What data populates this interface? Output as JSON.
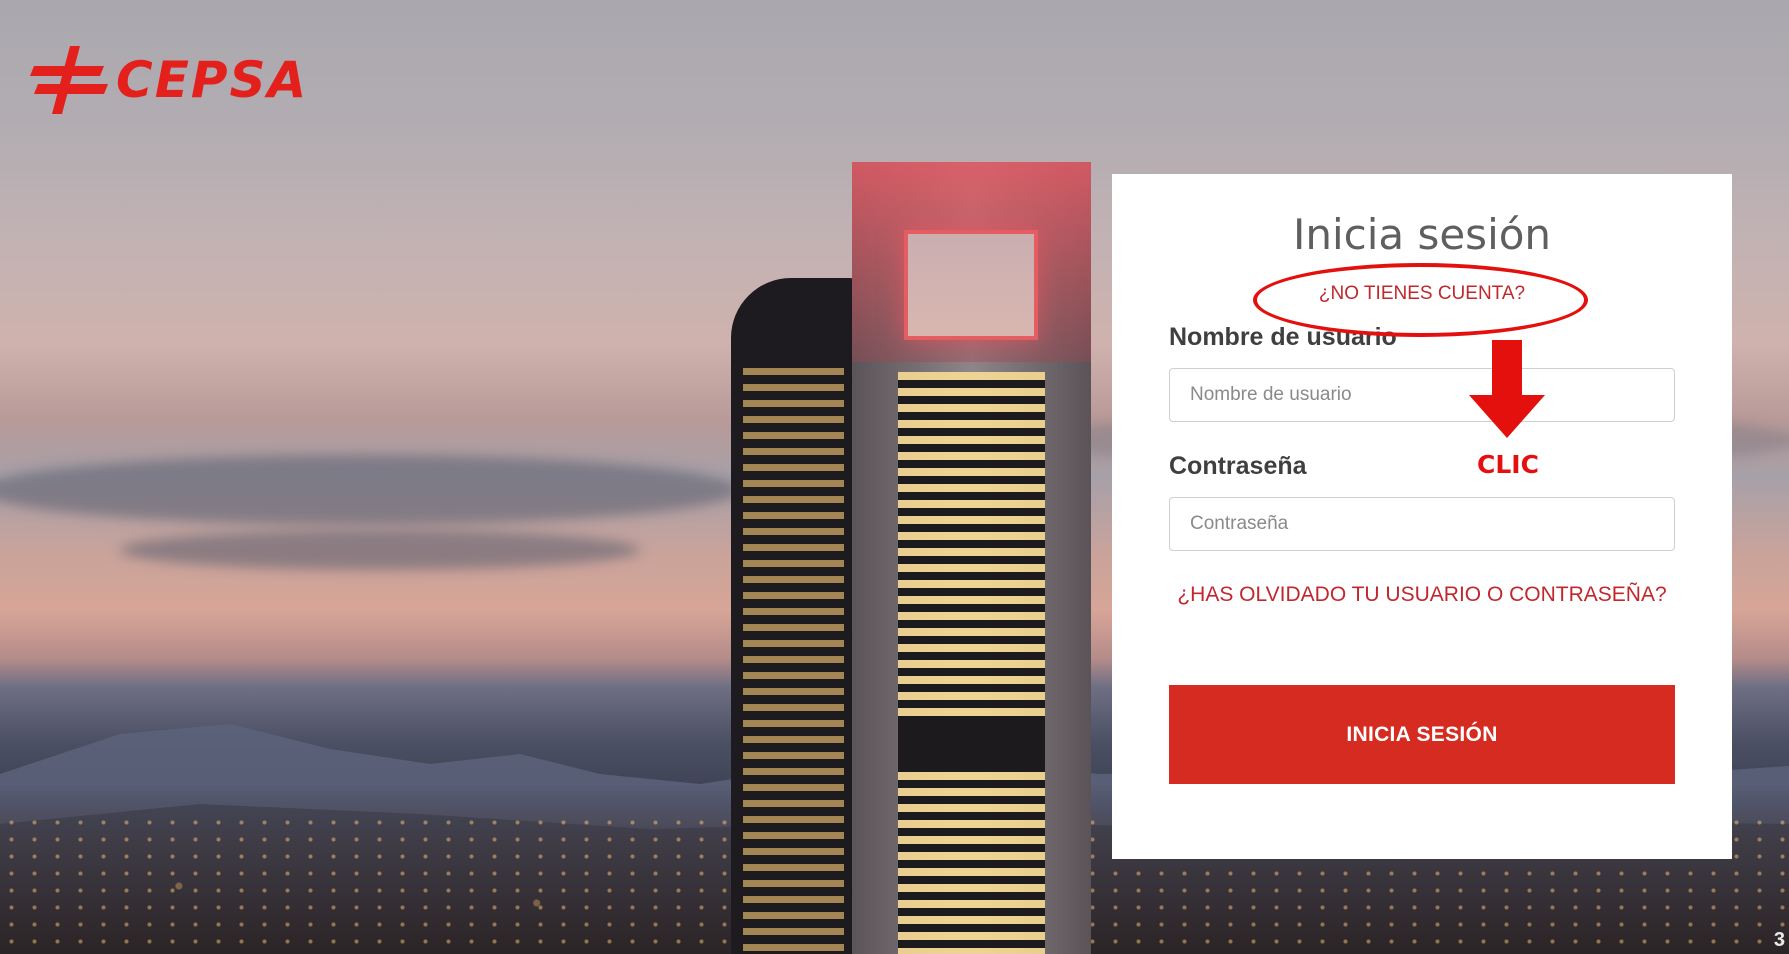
{
  "brand": {
    "name": "CEPSA",
    "color": "#e3201b"
  },
  "login": {
    "title": "Inicia sesión",
    "signup_link": "¿NO TIENES CUENTA?",
    "username_label": "Nombre de usuario",
    "username_placeholder": "Nombre de usuario",
    "password_label": "Contraseña",
    "password_placeholder": "Contraseña",
    "forgot_link": "¿HAS OLVIDADO TU USUARIO O CONTRASEÑA?",
    "submit_label": "INICIA SESIÓN",
    "accent_color": "#d52b20"
  },
  "annotation": {
    "label": "CLIC",
    "color": "#e3100e",
    "icon": "arrow-down-icon"
  },
  "page_number": "3"
}
